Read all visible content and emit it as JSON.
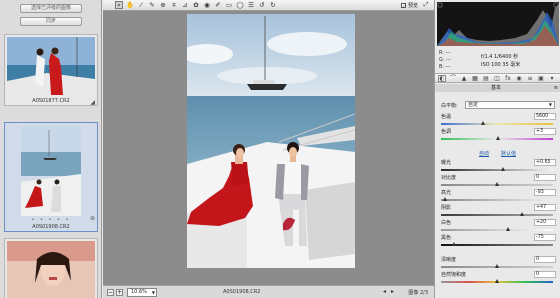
{
  "filmstrip": {
    "select_all_label": "选择已评级的图像",
    "sync_label": "同步",
    "items": [
      {
        "name": "A0S01877.CR2",
        "selected": false
      },
      {
        "name": "A0S01908.CR2",
        "selected": true,
        "dots": "• • • • •"
      },
      {
        "name": "",
        "selected": false
      }
    ]
  },
  "toolbar": {
    "tools": [
      "zoom-tool",
      "hand-tool",
      "white-balance-tool",
      "color-sampler-tool",
      "targeted-adjustment-tool",
      "crop-tool",
      "straighten-tool",
      "spot-removal-tool",
      "red-eye-tool",
      "adjustment-brush-tool",
      "graduated-filter-tool",
      "radial-filter-tool",
      "preferences",
      "rotate-ccw",
      "rotate-cw"
    ],
    "preview_label": "预览",
    "preview_checked": true
  },
  "status": {
    "zoom": "10.6%",
    "filename": "A0S01908.CR2",
    "count": "图像 2/3"
  },
  "panel": {
    "info": {
      "rgb_labels": [
        "R:",
        "G:",
        "B:"
      ],
      "rgb_values": [
        "---",
        "---",
        "---"
      ],
      "exif_line1": "f/1.4  1/6400 秒",
      "exif_line2": "ISO 100  35 毫米"
    },
    "section_title": "基本",
    "white_balance": {
      "label": "白平衡:",
      "value": "自定"
    },
    "temperature": {
      "label": "色温",
      "value": "5600",
      "pos": 0.38
    },
    "tint": {
      "label": "色调",
      "value": "+3",
      "pos": 0.51
    },
    "auto_label": "自动",
    "default_label": "默认值",
    "exposure": {
      "label": "曝光",
      "value": "+0.65",
      "pos": 0.56
    },
    "contrast": {
      "label": "对比度",
      "value": "0",
      "pos": 0.5
    },
    "highlights": {
      "label": "高光",
      "value": "-93",
      "pos": 0.04
    },
    "shadows": {
      "label": "阴影",
      "value": "+47",
      "pos": 0.73
    },
    "whites": {
      "label": "白色",
      "value": "+20",
      "pos": 0.6
    },
    "blacks": {
      "label": "黑色",
      "value": "-75",
      "pos": 0.12
    },
    "clarity": {
      "label": "清晰度",
      "value": "0",
      "pos": 0.5
    },
    "vibrance": {
      "label": "自然饱和度",
      "value": "0",
      "pos": 0.5
    }
  },
  "colors": {
    "accent": "#6b8fc9",
    "link": "#1e5aa8",
    "canvas_bg": "#8c8c8c"
  }
}
